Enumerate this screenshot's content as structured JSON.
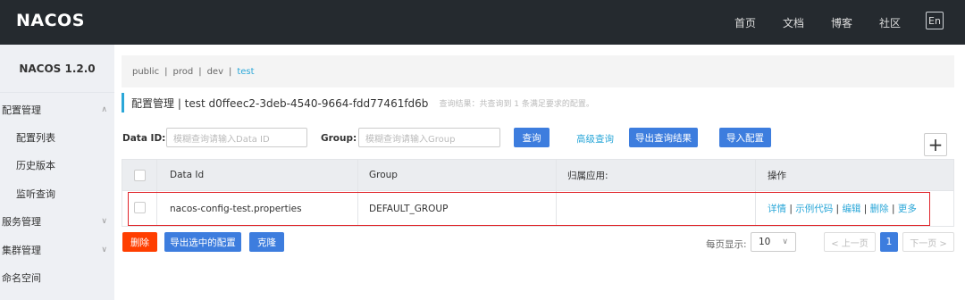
{
  "app": {
    "logo_text": "NACOS",
    "version_title": "NACOS 1.2.0"
  },
  "topnav": {
    "items": [
      "首页",
      "文档",
      "博客",
      "社区"
    ],
    "lang": "En"
  },
  "sidebar": {
    "items": [
      {
        "label": "配置管理",
        "expandable": true,
        "expanded": true
      },
      {
        "label": "配置列表",
        "sub": true
      },
      {
        "label": "历史版本",
        "sub": true
      },
      {
        "label": "监听查询",
        "sub": true
      },
      {
        "label": "服务管理",
        "expandable": true
      },
      {
        "label": "集群管理",
        "expandable": true
      },
      {
        "label": "命名空间"
      }
    ]
  },
  "namespaces": {
    "items": [
      "public",
      "prod",
      "dev",
      "test"
    ],
    "active": "test",
    "separator": "|"
  },
  "header": {
    "title": "配置管理  |  test  d0ffeec2-3deb-4540-9664-fdd77461fd6b",
    "hint": "查询结果：共查询到 1 条满足要求的配置。"
  },
  "search": {
    "dataid_label": "Data ID:",
    "dataid_placeholder": "模糊查询请输入Data ID",
    "group_label": "Group:",
    "group_placeholder": "模糊查询请输入Group",
    "query_btn": "查询",
    "advanced_btn": "高级查询",
    "export_btn": "导出查询结果",
    "import_btn": "导入配置"
  },
  "table": {
    "headers": [
      "Data Id",
      "Group",
      "归属应用:",
      "操作"
    ],
    "rows": [
      {
        "data_id": "nacos-config-test.properties",
        "group": "DEFAULT_GROUP",
        "app": ""
      }
    ],
    "ops": [
      "详情",
      "示例代码",
      "编辑",
      "删除",
      "更多"
    ]
  },
  "bulk": {
    "delete_btn": "删除",
    "export_selected_btn": "导出选中的配置",
    "clone_btn": "克隆"
  },
  "pager": {
    "per_page_label": "每页显示:",
    "per_page": "10",
    "prev": "< 上一页",
    "current": "1",
    "next": "下一页 >"
  },
  "colors": {
    "topbar": "#252a2f",
    "accent": "#2ba7d8",
    "primary_btn": "#3d7dde",
    "danger_btn": "#ff3e00",
    "highlight": "#e0242a"
  }
}
